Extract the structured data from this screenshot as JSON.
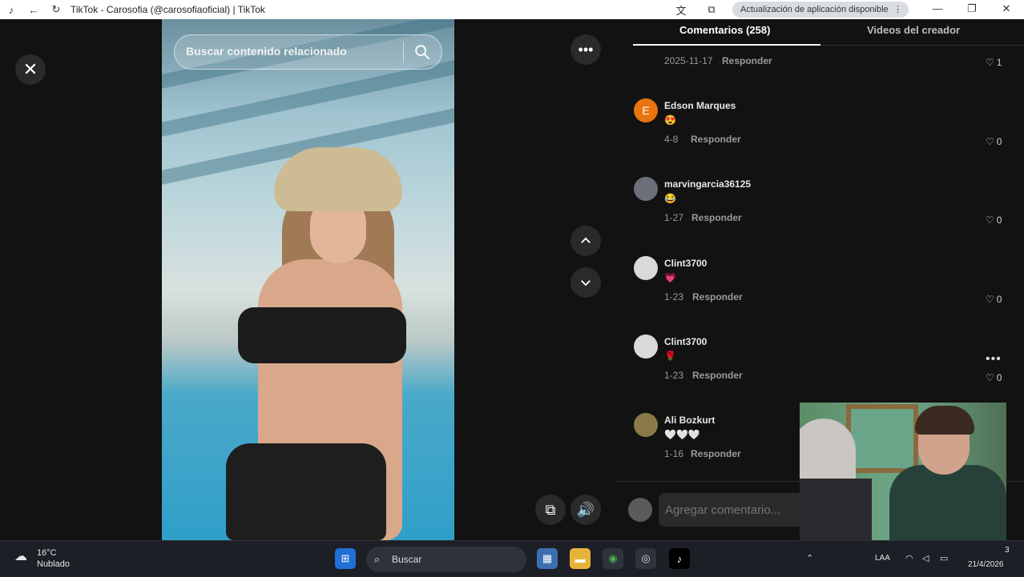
{
  "browser": {
    "title": "TikTok - Carosofia (@carosofiaoficial) | TikTok",
    "update_notice": "Actualización de aplicación disponible",
    "update_menu": "⋮"
  },
  "viewer": {
    "search_placeholder": "Buscar contenido relacionado"
  },
  "panel": {
    "tabs": [
      {
        "label": "Comentarios (258)",
        "active": true
      },
      {
        "label": "Videos del creador",
        "active": false
      }
    ],
    "reply_label": "Responder",
    "partial_comment": {
      "date": "2025-11-17",
      "likes": "1"
    },
    "comments": [
      {
        "user": "Edson Marques",
        "avatar_letter": "E",
        "avatar_color": "#e8740e",
        "text": "😍",
        "date": "4-8",
        "likes": "0"
      },
      {
        "user": "marvingarcia36125",
        "avatar_letter": "",
        "avatar_color": "#6b6f7a",
        "text": "😂",
        "date": "1-27",
        "likes": "0"
      },
      {
        "user": "Clint3700",
        "avatar_letter": "",
        "avatar_color": "#d9d9d9",
        "text": "💗",
        "date": "1-23",
        "likes": "0"
      },
      {
        "user": "Clint3700",
        "avatar_letter": "",
        "avatar_color": "#d9d9d9",
        "text": "🌹",
        "date": "1-23",
        "likes": "0"
      },
      {
        "user": "Ali Bozkurt",
        "avatar_letter": "",
        "avatar_color": "#8a7a4a",
        "text": "🤍🤍🤍",
        "date": "1-16",
        "likes": ""
      }
    ],
    "comment_placeholder": "Agregar comentario..."
  },
  "taskbar": {
    "weather_temp": "16°C",
    "weather_desc": "Nublado",
    "search_label": "Buscar",
    "lang": "LAA",
    "date": "21/4/2026",
    "notif_count": "3"
  }
}
